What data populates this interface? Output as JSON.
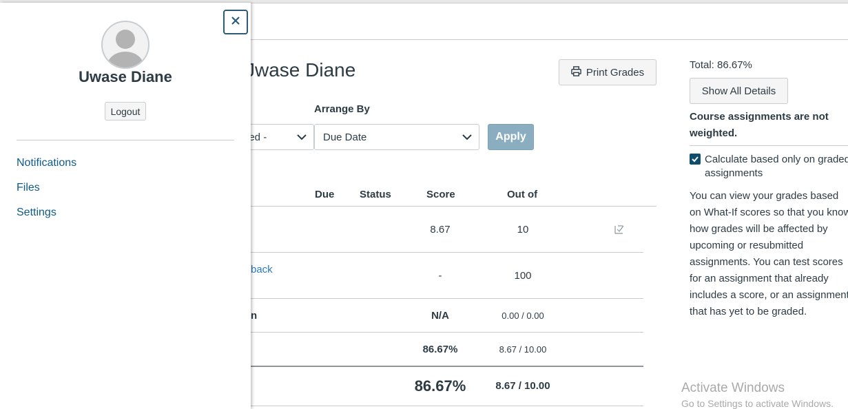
{
  "page": {
    "title_fragment": "Jwase Diane",
    "print_label": "Print Grades"
  },
  "filters": {
    "first_select_value": "ned -",
    "arrange_label": "Arrange By",
    "arrange_value": "Due Date",
    "apply_label": "Apply"
  },
  "table": {
    "headers": {
      "due": "Due",
      "status": "Status",
      "score": "Score",
      "out_of": "Out of"
    },
    "rows": [
      {
        "name": "",
        "score": "8.67",
        "out_of": "10"
      },
      {
        "name": "back",
        "score": "-",
        "out_of": "100"
      },
      {
        "name": "n",
        "score": "N/A",
        "out_of": "0.00 / 0.00"
      },
      {
        "name": "",
        "score": "86.67%",
        "out_of": "8.67 / 10.00"
      }
    ],
    "total": {
      "score": "86.67%",
      "out_of": "8.67 / 10.00"
    }
  },
  "right_panel": {
    "total": "Total: 86.67%",
    "show_details": "Show All Details",
    "weighted_note": "Course assignments are not weighted.",
    "checkbox_label": "Calculate based only on graded assignments",
    "checkbox_checked": true,
    "whatif_text": "You can view your grades based on What-If scores so that you know how grades will be affected by upcoming or resubmitted assignments. You can test scores for an assignment that already includes a score, or an assignment that has yet to be graded."
  },
  "watermark": {
    "title": "Activate Windows",
    "subtitle": "Go to Settings to activate Windows."
  },
  "tray": {
    "user_name": "Uwase Diane",
    "logout_label": "Logout",
    "links": [
      "Notifications",
      "Files",
      "Settings"
    ]
  },
  "colors": {
    "link": "#0e5a86",
    "apply_bg": "#8aaebf",
    "checkbox": "#0e4d6d"
  },
  "icons": {
    "print": "printer-icon",
    "close": "close-icon",
    "avatar": "avatar-icon",
    "what_if": "what-if-icon"
  }
}
